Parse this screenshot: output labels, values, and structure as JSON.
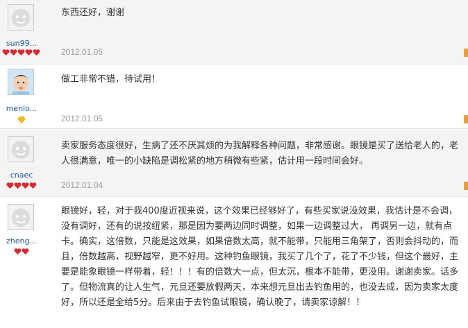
{
  "reviews": [
    {
      "username": "sun99...",
      "avatar": "default-face-avatar",
      "rank_badge": "red-heart-5",
      "text": "东西还好，谢谢",
      "date": "2012.01.05"
    },
    {
      "username": "menlo...",
      "avatar": "baby-photo-avatar",
      "rank_badge": "yellow-diamond-1",
      "text": "做工非常不错，待试用！",
      "date": "2012.01.05"
    },
    {
      "username": "cnaec",
      "avatar": "default-face-avatar",
      "rank_badge": "red-heart-4",
      "text": "卖家服务态度很好，生病了还不厌其烦的为我解释各种问题，非常感谢。眼镜是买了送给老人的，老人很满意，唯一的小缺陷是调松紧的地方稍微有些紧，估计用一段时间会好。",
      "date": "2012.01.04"
    },
    {
      "username": "zheng...",
      "avatar": "default-face-avatar",
      "rank_badge": "red-heart-2",
      "text": "眼镜好，轻，对于我400度近视来说，这个效果已经够好了，有些买家说没效果，我估计是不会调，没有调好，还有的说按纽紧，那是因为要两边同时调整，如果一边调整过大， 再调另一边，就有点卡。确实，这倍数，只能是这效果，如果倍数太高，就不能带，只能用三角架了，否则会抖动的，而且，倍数越高，视野越窄，更不好用。这种钓鱼眼镜，我买了几个了，花了不少钱，但这个最好，主要是能象眼镜一样带着，轻！！！有的倍数大一点，但太沉，根本不能带，更没用。谢谢卖家。话多了。但物流真的让人生气，元旦还要放假两天，本来想元旦出去钓鱼用的，也没去成，因为卖家太度好，所以还是全给5分。后来由于去钓鱼试眼镜，确认晚了，请卖家谅解！！",
      "date": ""
    }
  ],
  "colors": {
    "username": "#1a5aa8",
    "heart": "#e0262c",
    "diamond": "#f5c400",
    "date": "#999999"
  }
}
